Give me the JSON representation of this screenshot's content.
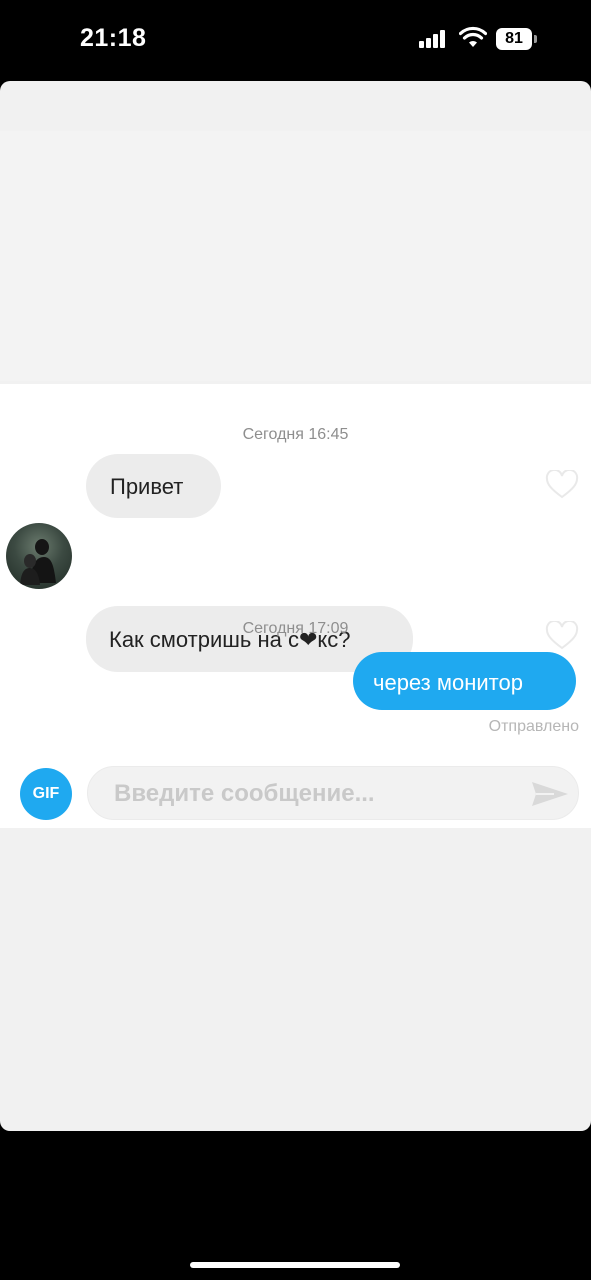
{
  "status_bar": {
    "time": "21:18",
    "battery": "81"
  },
  "chat": {
    "groups": [
      {
        "timestamp": "Сегодня 16:45",
        "messages": [
          {
            "text": "Привет",
            "direction": "incoming"
          },
          {
            "text": "Как смотришь на с❤кс?",
            "direction": "incoming"
          }
        ]
      },
      {
        "timestamp": "Сегодня 17:09",
        "messages": [
          {
            "text": "через монитор",
            "direction": "outgoing",
            "status": "Отправлено"
          }
        ]
      }
    ]
  },
  "composer": {
    "gif_label": "GIF",
    "placeholder": "Введите сообщение..."
  },
  "colors": {
    "accent": "#1fa9f0",
    "incoming_bubble": "#ececec",
    "background": "#000000"
  },
  "icons": [
    "signal-icon",
    "wifi-icon",
    "battery-icon",
    "heart-icon",
    "send-icon",
    "avatar"
  ]
}
